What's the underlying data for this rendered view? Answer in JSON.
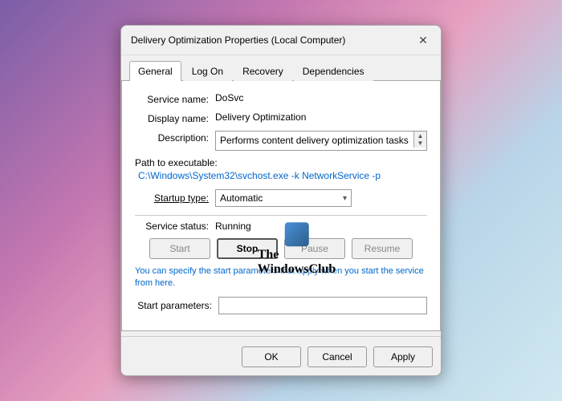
{
  "dialog": {
    "title": "Delivery Optimization Properties (Local Computer)",
    "close_label": "✕"
  },
  "tabs": [
    {
      "label": "General",
      "active": true
    },
    {
      "label": "Log On",
      "active": false
    },
    {
      "label": "Recovery",
      "active": false
    },
    {
      "label": "Dependencies",
      "active": false
    }
  ],
  "fields": {
    "service_name_label": "Service name:",
    "service_name_value": "DoSvc",
    "display_name_label": "Display name:",
    "display_name_value": "Delivery Optimization",
    "description_label": "Description:",
    "description_value": "Performs content delivery optimization tasks",
    "path_label": "Path to executable:",
    "path_value": "C:\\Windows\\System32\\svchost.exe -k NetworkService -p",
    "startup_label": "Startup type:",
    "startup_value": "Automatic",
    "service_status_label": "Service status:",
    "service_status_value": "Running"
  },
  "service_buttons": {
    "start_label": "Start",
    "stop_label": "Stop",
    "pause_label": "Pause",
    "resume_label": "Resume"
  },
  "hint_text": "You can specify the start parameters that apply when you start the service from here.",
  "start_params_label": "Start parameters:",
  "start_params_placeholder": "",
  "footer": {
    "ok_label": "OK",
    "cancel_label": "Cancel",
    "apply_label": "Apply"
  },
  "watermark": {
    "text_line1": "The",
    "text_line2": "WindowsClub"
  }
}
